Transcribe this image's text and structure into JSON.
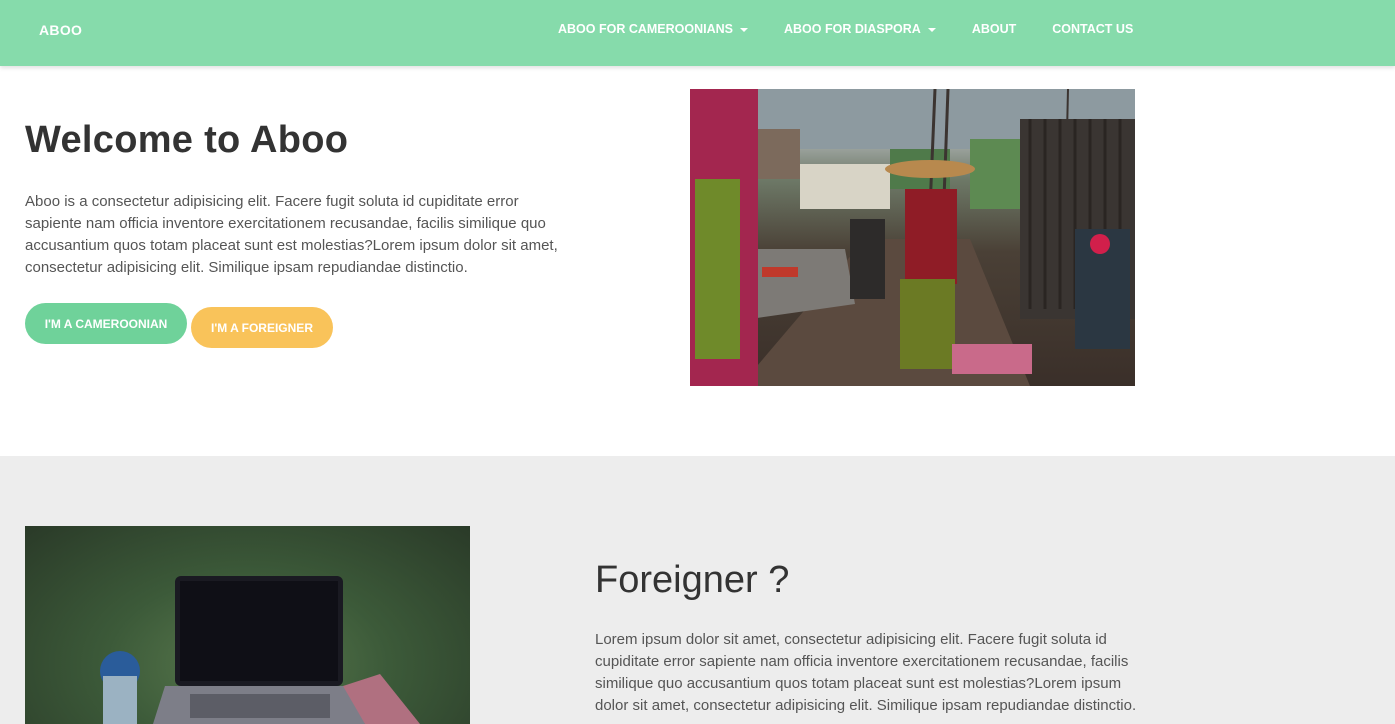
{
  "colors": {
    "navbar": "#86dbab",
    "primary_button": "#6fd29a",
    "secondary_button": "#f9c35a",
    "section_bg": "#ededed",
    "heading": "#333333",
    "body_text": "#555555"
  },
  "navbar": {
    "brand": "ABOO",
    "items": [
      {
        "label": "ABOO FOR CAMEROONIANS",
        "dropdown": true
      },
      {
        "label": "ABOO FOR DIASPORA",
        "dropdown": true
      },
      {
        "label": "ABOUT",
        "dropdown": false
      },
      {
        "label": "CONTACT US",
        "dropdown": false
      }
    ]
  },
  "hero": {
    "title": "Welcome to Aboo",
    "text": "Aboo is a consectetur adipisicing elit. Facere fugit soluta id cupiditate error sapiente nam officia inventore exercitationem recusandae, facilis similique quo accusantium quos totam placeat sunt est molestias?Lorem ipsum dolor sit amet, consectetur adipisicing elit. Similique ipsam repudiandae distinctio.",
    "buttons": {
      "cameroonian": "I'M A CAMEROONIAN",
      "foreigner": "I'M A FOREIGNER"
    },
    "image_icon": "street-market-photo"
  },
  "foreigner_section": {
    "title": "Foreigner ?",
    "text": "Lorem ipsum dolor sit amet, consectetur adipisicing elit. Facere fugit soluta id cupiditate error sapiente nam officia inventore exercitationem recusandae, facilis similique quo accusantium quos totam placeat sunt est molestias?Lorem ipsum dolor sit amet, consectetur adipisicing elit. Similique ipsam repudiandae distinctio.",
    "image_icon": "laptop-desk-photo"
  }
}
